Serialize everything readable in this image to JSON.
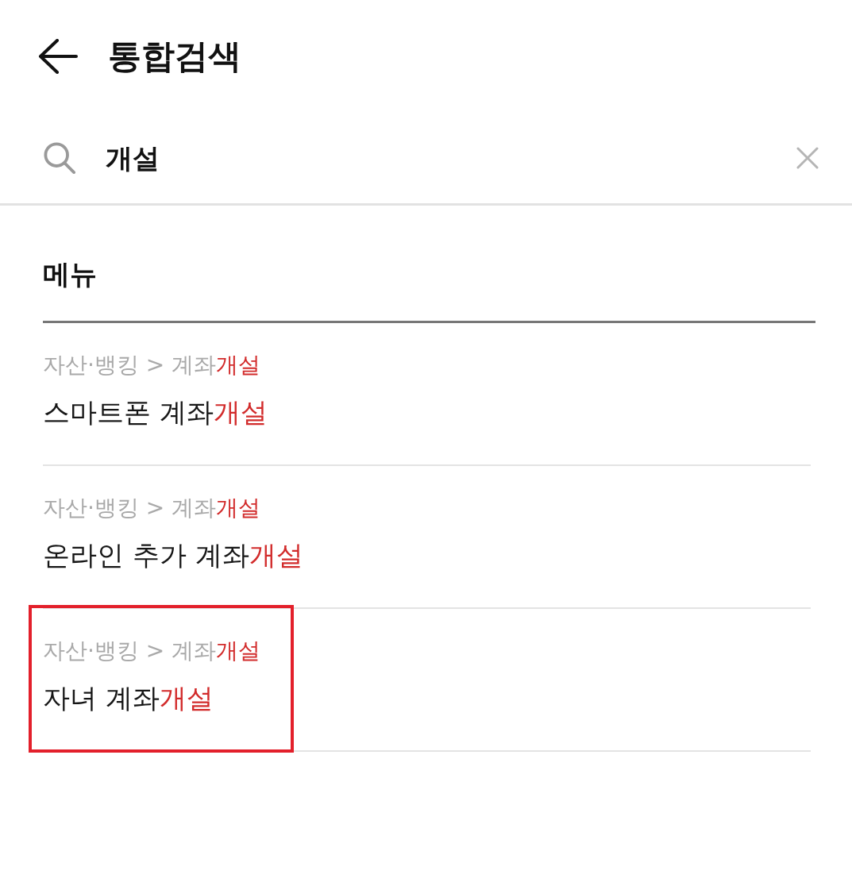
{
  "header": {
    "title": "통합검색"
  },
  "search": {
    "value": "개설"
  },
  "section": {
    "title": "메뉴"
  },
  "results": [
    {
      "breadcrumb": [
        {
          "text": "자산·뱅킹 > 계좌",
          "match": false
        },
        {
          "text": "개설",
          "match": true
        }
      ],
      "title": [
        {
          "text": "스마트폰 계좌",
          "match": false
        },
        {
          "text": "개설",
          "match": true
        }
      ],
      "highlighted": false
    },
    {
      "breadcrumb": [
        {
          "text": "자산·뱅킹 > 계좌",
          "match": false
        },
        {
          "text": "개설",
          "match": true
        }
      ],
      "title": [
        {
          "text": "온라인 추가 계좌",
          "match": false
        },
        {
          "text": "개설",
          "match": true
        }
      ],
      "highlighted": false
    },
    {
      "breadcrumb": [
        {
          "text": "자산·뱅킹 > 계좌",
          "match": false
        },
        {
          "text": "개설",
          "match": true
        }
      ],
      "title": [
        {
          "text": "자녀 계좌",
          "match": false
        },
        {
          "text": "개설",
          "match": true
        }
      ],
      "highlighted": true
    }
  ]
}
